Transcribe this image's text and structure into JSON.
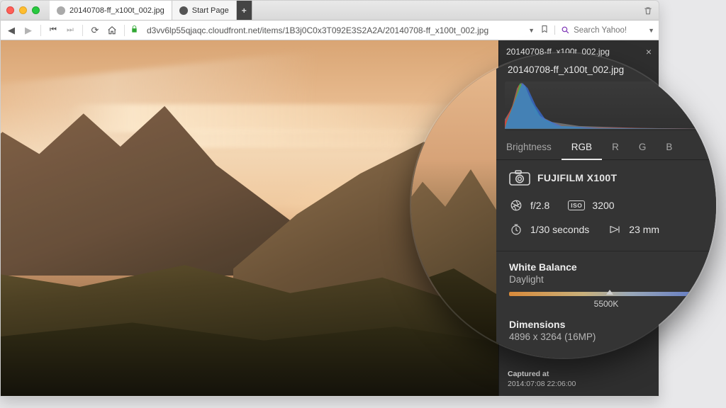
{
  "browser": {
    "tabs": [
      {
        "label": "20140708-ff_x100t_002.jpg",
        "active": true
      },
      {
        "label": "Start Page",
        "active": false
      }
    ],
    "url": "d3vv6lp55qjaqc.cloudfront.net/items/1B3j0C0x3T092E3S2A2A/20140708-ff_x100t_002.jpg",
    "search_placeholder": "Search Yahoo!"
  },
  "sidebar": {
    "filename": "20140708-ff_x100t_002.jpg",
    "captured_label": "Captured at",
    "captured_value": "2014:07:08 22:06:00"
  },
  "inspector": {
    "filename": "20140708-ff_x100t_002.jpg",
    "histo_tabs": {
      "brightness": "Brightness",
      "rgb": "RGB",
      "r": "R",
      "g": "G",
      "b": "B"
    },
    "camera": "FUJIFILM X100T",
    "aperture": "f/2.8",
    "iso_label": "ISO",
    "iso": "3200",
    "shutter": "1/30 seconds",
    "focal": "23 mm",
    "wb_label": "White Balance",
    "wb_value": "Daylight",
    "wb_k": "5500K",
    "dim_label": "Dimensions",
    "dim_value": "4896 x 3264 (16MP)"
  }
}
